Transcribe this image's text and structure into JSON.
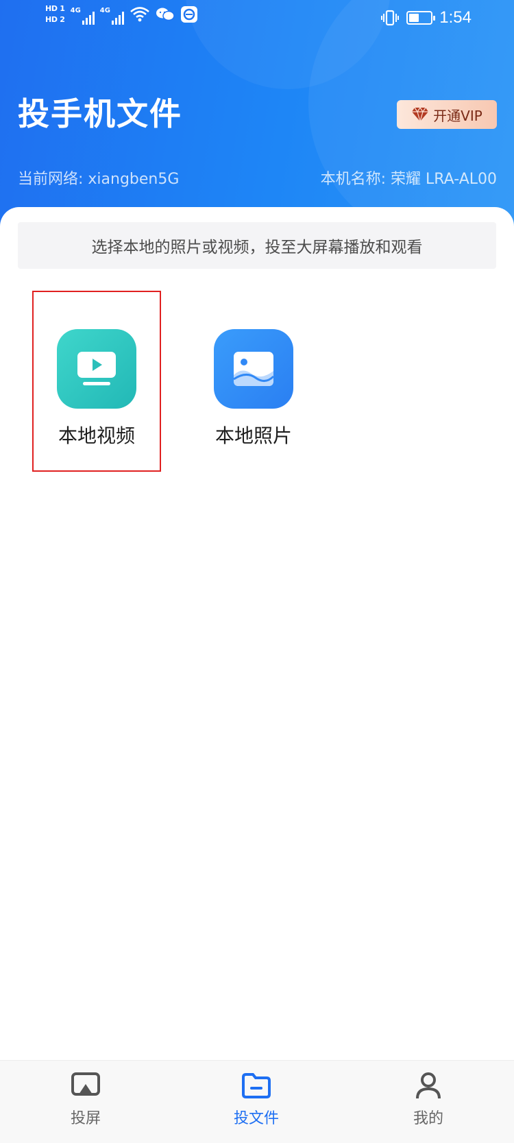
{
  "status_bar": {
    "sim1": "HD 1",
    "sim2": "HD 2",
    "net1": "4G",
    "net2": "4G",
    "time": "1:54",
    "battery_level": 0.45,
    "icons": [
      "signal-icon",
      "wifi-icon",
      "wechat-icon",
      "app-notification-icon",
      "vibrate-icon",
      "battery-icon"
    ]
  },
  "header": {
    "title": "投手机文件",
    "vip_label": "开通VIP",
    "network": "当前网络: xiangben5G",
    "device": "本机名称: 荣耀 LRA-AL00",
    "colors": {
      "gradient_start": "#1f6ff0",
      "gradient_end": "#2a95f7"
    }
  },
  "content": {
    "hint": "选择本地的照片或视频，投至大屏幕播放和观看",
    "tiles": [
      {
        "label": "本地视频",
        "icon": "video-icon",
        "color": "#2ec8c0",
        "selected": true
      },
      {
        "label": "本地照片",
        "icon": "photo-icon",
        "color": "#318cf7",
        "selected": false
      }
    ]
  },
  "bottom_nav": {
    "items": [
      {
        "label": "投屏",
        "icon": "screen-cast-icon",
        "active": false
      },
      {
        "label": "投文件",
        "icon": "folder-icon",
        "active": true
      },
      {
        "label": "我的",
        "icon": "user-icon",
        "active": false
      }
    ],
    "active_color": "#1e6ff2"
  }
}
